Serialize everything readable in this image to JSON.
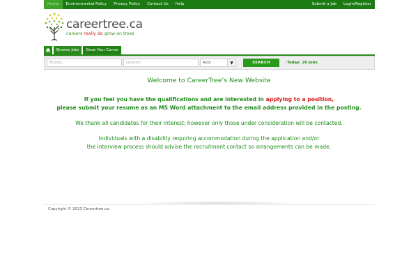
{
  "topbar": {
    "left_links": [
      "Home",
      "Environmental Policy",
      "Privacy Policy",
      "Contact Us",
      "Help"
    ],
    "right_links": [
      "Submit a Job",
      "Login/Register"
    ]
  },
  "logo": {
    "brand": "careertree.ca",
    "tagline_pre": "careers ",
    "tagline_red": "really do",
    "tagline_post": " grow on trees"
  },
  "nav": {
    "home_icon": "home-icon",
    "tabs": [
      "Browse Jobs",
      "Grow Your Career"
    ]
  },
  "search": {
    "keyword_placeholder": "All Jobs",
    "location_placeholder": "Location",
    "select_value": "Auto",
    "button_label": "SEARCH",
    "today_label": "Today: 20 Jobs"
  },
  "content": {
    "welcome": "Welcome to CareerTree’s New Website",
    "p1_pre": "If you feel you have the qualifications and are interested in ",
    "p1_red": "applying to a position,",
    "p1_line2": "please submit your resume as an MS Word attachment to the email address provided in the posting.",
    "p2": "We thank all candidates for their interest; however only those under consideration will be contacted.",
    "p3_line1": "Individuals with a disability requiring accommodation during the application and/or",
    "p3_line2": "the interview process should advise the recruitment contact so arrangements can be made."
  },
  "footer": {
    "copyright": "Copyright © 2023 Careertree.ca."
  },
  "colors": {
    "brand_green": "#1b7a12",
    "accent_red": "#d21919"
  }
}
